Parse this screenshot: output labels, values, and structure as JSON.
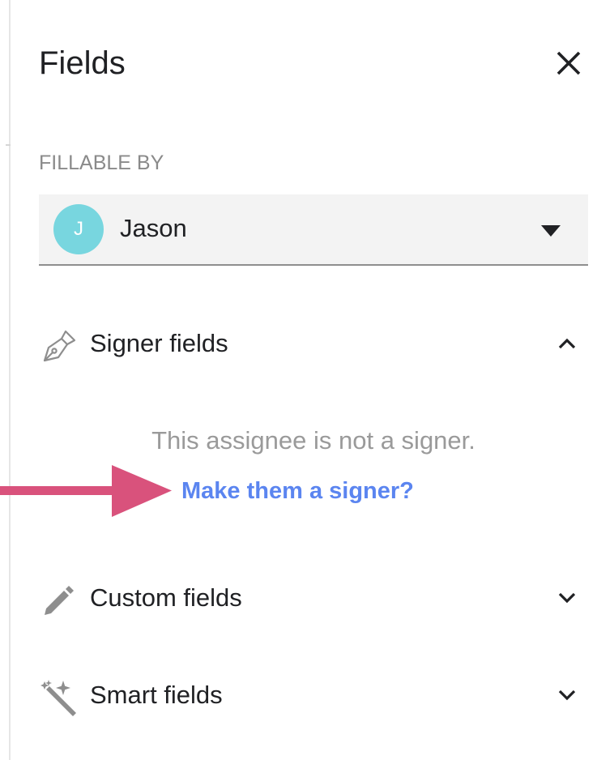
{
  "panel": {
    "title": "Fields",
    "close_icon": "close-icon"
  },
  "fillable_by": {
    "label": "FILLABLE BY",
    "selected": {
      "initial": "J",
      "name": "Jason",
      "avatar_color": "#78d6df"
    },
    "dropdown_icon": "caret-down-icon"
  },
  "sections": {
    "signer": {
      "label": "Signer fields",
      "icon": "pen-nib-icon",
      "expanded": true,
      "chevron_icon": "chevron-up-icon",
      "empty_message": "This assignee is not a signer.",
      "action_link": "Make them a signer?"
    },
    "custom": {
      "label": "Custom fields",
      "icon": "pencil-icon",
      "expanded": false,
      "chevron_icon": "chevron-down-icon"
    },
    "smart": {
      "label": "Smart fields",
      "icon": "magic-wand-icon",
      "expanded": false,
      "chevron_icon": "chevron-down-icon"
    }
  },
  "colors": {
    "link": "#5b85f0",
    "annotation_arrow": "#d9527c",
    "muted_text": "#9a9a9a",
    "select_background": "#f3f3f3"
  },
  "annotation": {
    "icon": "arrow-right-icon"
  }
}
